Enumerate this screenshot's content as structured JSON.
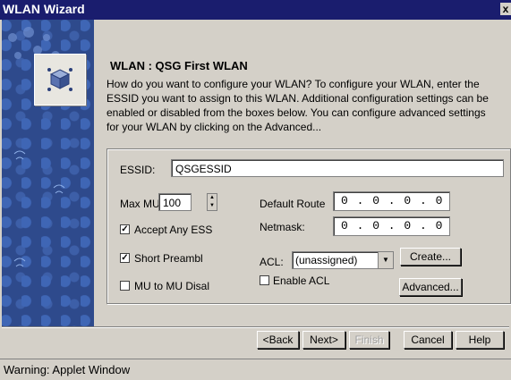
{
  "window": {
    "title": "WLAN Wizard",
    "close_label": "x"
  },
  "header": {
    "title": "WLAN :  QSG First WLAN",
    "description": "How do you want to configure your WLAN? To configure your WLAN, enter the ESSID you want to assign to this WLAN. Additional configuration settings can be enabled or disabled from the boxes below. You can configure advanced settings for your WLAN by clicking on the Advanced..."
  },
  "form": {
    "essid_label": "ESSID:",
    "essid_value": "QSGESSID",
    "max_mu_label": "Max MU",
    "max_mu_value": "100",
    "default_route_label": "Default Route",
    "default_route_value": "0 . 0 . 0 . 0",
    "netmask_label": "Netmask:",
    "netmask_value": "0 . 0 . 0 . 0",
    "accept_any_essid_label": "Accept Any ESS",
    "accept_any_essid_checked": true,
    "short_preamble_label": "Short Preambl",
    "short_preamble_checked": true,
    "mu_to_mu_label": "MU to MU Disal",
    "mu_to_mu_checked": false,
    "acl_label": "ACL:",
    "acl_value": "(unassigned)",
    "create_label": "Create...",
    "enable_acl_label": "Enable ACL",
    "enable_acl_checked": false,
    "advanced_label": "Advanced..."
  },
  "footer": {
    "back_label": "<Back",
    "next_label": "Next>",
    "finish_label": "Finish",
    "cancel_label": "Cancel",
    "help_label": "Help"
  },
  "status": {
    "text": "Warning: Applet Window"
  },
  "colors": {
    "titlebar": "#1a1d6e",
    "sidebar": "#2e4a8c",
    "face": "#d4d0c8"
  }
}
